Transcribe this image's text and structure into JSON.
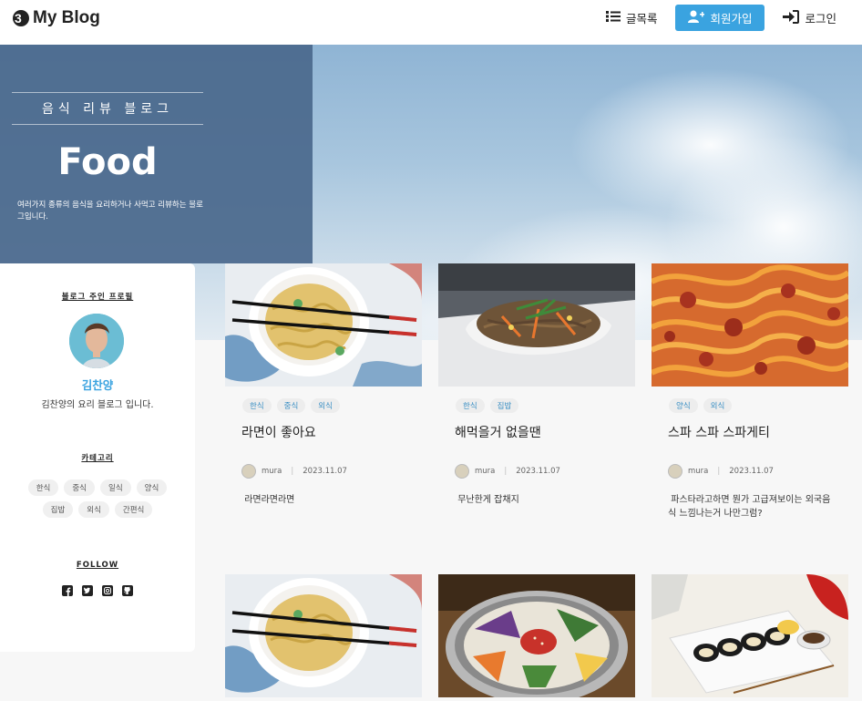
{
  "header": {
    "logo_text": "My Blog",
    "nav": {
      "list_label": "글목록",
      "signup_label": "회원가입",
      "login_label": "로그인"
    }
  },
  "hero": {
    "subtitle": "음식 리뷰 블로그",
    "title": "Food",
    "description": "여러가지 종류의 음식을 요리하거나 사먹고 리뷰하는 블로그입니다."
  },
  "sidebar": {
    "profile_heading": "블로그 주인 프로필",
    "owner_name": "김찬양",
    "owner_intro": "김찬양의 요리 블로그 입니다.",
    "category_heading": "카테고리",
    "categories": [
      "한식",
      "중식",
      "일식",
      "양식",
      "집밥",
      "외식",
      "간편식"
    ],
    "follow_heading": "FOLLOW",
    "social_icons": [
      "facebook-icon",
      "twitter-icon",
      "instagram-icon",
      "github-icon"
    ]
  },
  "posts": [
    {
      "tags": [
        "한식",
        "중식",
        "외식"
      ],
      "title": "라면이 좋아요",
      "author": "mura",
      "date": "2023.11.07",
      "excerpt": " 라면라면라면",
      "image": "ramen"
    },
    {
      "tags": [
        "한식",
        "집밥"
      ],
      "title": "해먹을거 없을땐",
      "author": "mura",
      "date": "2023.11.07",
      "excerpt": " 무난한게 잡채지",
      "image": "japchae"
    },
    {
      "tags": [
        "양식",
        "외식"
      ],
      "title": "스파 스파 스파게티",
      "author": "mura",
      "date": "2023.11.07",
      "excerpt": " 파스타라고하면 뭔가 고급져보이는 외국음식 느낌나는거 나만그럼?",
      "image": "spaghetti"
    },
    {
      "tags": [],
      "title": "",
      "author": "",
      "date": "",
      "excerpt": "",
      "image": "ramen"
    },
    {
      "tags": [],
      "title": "",
      "author": "",
      "date": "",
      "excerpt": "",
      "image": "bibimbap"
    },
    {
      "tags": [],
      "title": "",
      "author": "",
      "date": "",
      "excerpt": "",
      "image": "kimbap"
    }
  ],
  "colors": {
    "accent": "#3aa3e0",
    "hero_panel": "#4a688c",
    "page_bg": "#f7f7f7"
  }
}
